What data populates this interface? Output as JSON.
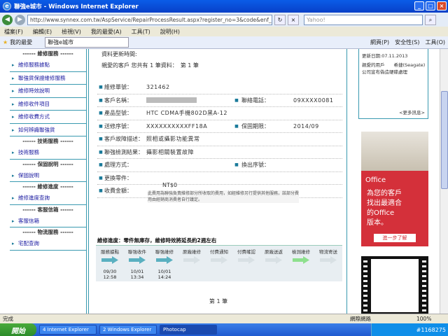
{
  "window": {
    "title": "聯強e城市 - Windows Internet Explorer",
    "minimize": "_",
    "maximize": "□",
    "close": "×"
  },
  "address": {
    "url": "http://www.synnex.com.tw/AspService/RepairProcessResult.aspx?register_no=3&code&enf_mem=&tel_code=",
    "search_placeholder": "Yahoo!"
  },
  "menu": [
    "檔案(F)",
    "編輯(E)",
    "檢視(V)",
    "我的最愛(A)",
    "工具(T)",
    "說明(H)"
  ],
  "favbar": {
    "favorites": "我的最愛",
    "tab": "聯強e城市",
    "tools": [
      "網頁(P)",
      "安全性(S)",
      "工具(O)"
    ]
  },
  "sidebar": [
    {
      "type": "section",
      "label": "------ 維修服務 ------"
    },
    {
      "type": "item",
      "label": "維修服務據點"
    },
    {
      "type": "item",
      "label": "聯強貨保證維修服務"
    },
    {
      "type": "item",
      "label": "維修時效說明"
    },
    {
      "type": "item",
      "label": "維修收件項目"
    },
    {
      "type": "item",
      "label": "維修收費方式"
    },
    {
      "type": "item",
      "label": "如何辨識聯強貨"
    },
    {
      "type": "section",
      "label": "------ 技術服務 ------"
    },
    {
      "type": "item",
      "label": "技術服務"
    },
    {
      "type": "section",
      "label": "------ 保固說明 ------"
    },
    {
      "type": "item",
      "label": "保固說明"
    },
    {
      "type": "section",
      "label": "------ 維修進度 ------"
    },
    {
      "type": "item",
      "label": "維修進度查詢"
    },
    {
      "type": "section",
      "label": "------ 客服信箱 ------"
    },
    {
      "type": "item",
      "label": "客服信箱"
    },
    {
      "type": "section",
      "label": "------ 物流服務 ------"
    },
    {
      "type": "item",
      "label": "宅配查詢"
    }
  ],
  "main": {
    "line1": "資料更新時間:",
    "line2": "親愛的客戶 您共有 1 筆資料：　第 1 筆",
    "rows": [
      {
        "label": "維修單號：",
        "value": "321462"
      },
      {
        "label": "客戶名稱：",
        "value": "",
        "label2": "聯絡電話：",
        "value2": "09XXXX0081"
      },
      {
        "label": "產品型號：",
        "value": "HTC CDMA手機802D黑A-12"
      },
      {
        "label": "送修序號：",
        "value": "XXXXXXXXXXFF18A",
        "label2": "保固期限：",
        "value2": "2014/09"
      },
      {
        "label": "客戶故障描述：",
        "value": "照相或攝影功能異常"
      },
      {
        "label": "聯強檢測結果：",
        "value": "攝影相關裝置故障"
      },
      {
        "label": "處理方式：",
        "value": "",
        "label2": "換出序號：",
        "value2": ""
      },
      {
        "label": "更換零件：",
        "value": ""
      },
      {
        "label": "收費金額：",
        "value": ""
      }
    ],
    "fee": "NT$0",
    "note": "此費用為聯強負責維修部分所收取的費用，如經維修另行提供其他服務，該部分費用由經銷商消費者自行議定。",
    "progress_title": "維修進度：零件無庫存，維修時效將延長約2週左右",
    "steps": [
      {
        "label": "服務據點",
        "date": "09/30",
        "time": "12:58",
        "done": true
      },
      {
        "label": "聯強收件",
        "date": "10/01",
        "time": "13:34",
        "done": true
      },
      {
        "label": "聯強維修",
        "date": "10/01",
        "time": "14:24",
        "done": true
      },
      {
        "label": "原廠維修",
        "date": "",
        "time": "",
        "done": false
      },
      {
        "label": "付費通知",
        "date": "",
        "time": "",
        "done": false
      },
      {
        "label": "付費確認",
        "date": "",
        "time": "",
        "done": false
      },
      {
        "label": "原廠送返",
        "date": "",
        "time": "",
        "done": false
      },
      {
        "label": "檢測維修",
        "date": "",
        "time": "",
        "done": false,
        "current": true
      },
      {
        "label": "物流寄送",
        "date": "",
        "time": "",
        "done": false
      }
    ],
    "pager": "第 1 筆"
  },
  "right": {
    "updated": "更新日期:07.11.2013",
    "news": "親愛的用戶　　希捷(Seagate)公司宣布偽造硬碟處理",
    "more": "<更多訊息>",
    "ad": {
      "brand": "Office",
      "copy": [
        "為您的客戶",
        "找出最適合",
        "的Office",
        "版本。"
      ],
      "cta": "進一步了解"
    }
  },
  "status": {
    "left": "完成",
    "zone": "網際網路",
    "zoom": "100%"
  },
  "taskbar": {
    "start": "開始",
    "items": [
      "4 Internet Explorer",
      "2 Windows Explorer",
      "Photocap"
    ],
    "watermark": "#1168275"
  },
  "colors": {
    "accent": "#3a9ab0",
    "progress_done": "#5ab0c0",
    "progress_current": "#8ee08e",
    "ad_red": "#d4303a"
  }
}
